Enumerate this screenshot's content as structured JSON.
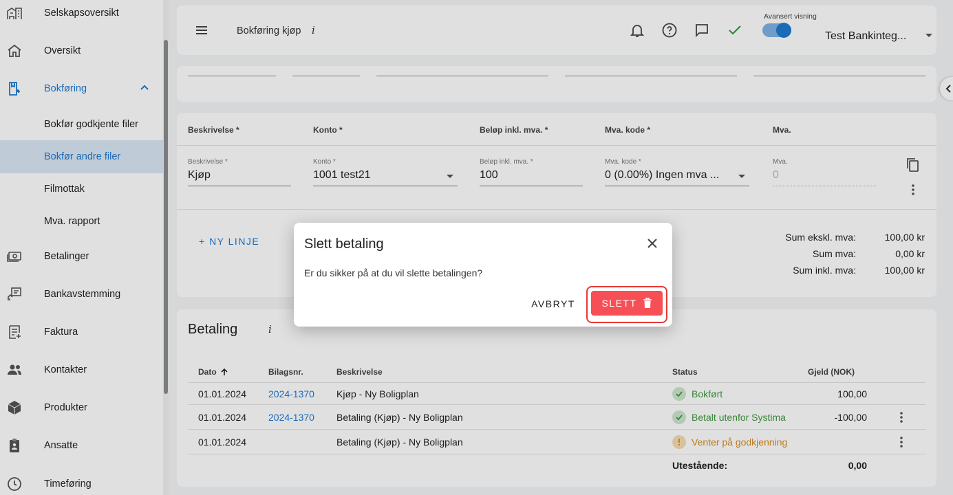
{
  "sidebar": {
    "items": [
      {
        "label": "Selskapsoversikt",
        "icon": "company-overview-icon"
      },
      {
        "label": "Oversikt",
        "icon": "home-icon"
      },
      {
        "label": "Bokføring",
        "icon": "bookkeeping-icon"
      },
      {
        "label": "Bokfør godkjente filer"
      },
      {
        "label": "Bokfør andre filer"
      },
      {
        "label": "Filmottak"
      },
      {
        "label": "Mva. rapport"
      },
      {
        "label": "Betalinger",
        "icon": "payments-icon"
      },
      {
        "label": "Bankavstemming",
        "icon": "bank-reconciliation-icon"
      },
      {
        "label": "Faktura",
        "icon": "invoice-icon"
      },
      {
        "label": "Kontakter",
        "icon": "contacts-icon"
      },
      {
        "label": "Produkter",
        "icon": "products-icon"
      },
      {
        "label": "Ansatte",
        "icon": "employees-icon"
      },
      {
        "label": "Timeføring",
        "icon": "time-tracking-icon"
      }
    ],
    "active_item": "Bokfør andre filer",
    "accent": "#1f7ad0"
  },
  "header": {
    "title": "Bokføring kjøp",
    "info": "i",
    "advanced_view_label": "Avansert visning",
    "advanced_view_on": true,
    "company": "Test Bankinteg..."
  },
  "line_table": {
    "headers": [
      "Beskrivelse *",
      "Konto *",
      "Beløp inkl. mva. *",
      "Mva. kode *",
      "Mva."
    ],
    "row": {
      "beskrivelse_label": "Beskrivelse *",
      "beskrivelse": "Kjøp",
      "konto_label": "Konto *",
      "konto": "1001 test21",
      "belop_label": "Beløp inkl. mva. *",
      "belop": "100",
      "mva_kode_label": "Mva. kode *",
      "mva_kode": "0 (0.00%) Ingen mva ...",
      "mva_label": "Mva.",
      "mva": "0"
    },
    "new_line": "+ NY LINJE",
    "sums": [
      {
        "label": "Sum ekskl. mva:",
        "value": "100,00 kr"
      },
      {
        "label": "Sum mva:",
        "value": "0,00 kr"
      },
      {
        "label": "Sum inkl. mva:",
        "value": "100,00 kr"
      }
    ]
  },
  "betaling": {
    "title": "Betaling",
    "info": "i",
    "columns": [
      "Dato",
      "Bilagsnr.",
      "Beskrivelse",
      "Status",
      "Gjeld (NOK)"
    ],
    "rows": [
      {
        "dato": "01.01.2024",
        "bilag": "2024-1370",
        "beskrivelse": "Kjøp - Ny Boligplan",
        "status": "Bokført",
        "status_type": "success",
        "gjeld": "100,00"
      },
      {
        "dato": "01.01.2024",
        "bilag": "2024-1370",
        "beskrivelse": "Betaling (Kjøp) - Ny Boligplan",
        "status": "Betalt utenfor Systima",
        "status_type": "success",
        "gjeld": "-100,00"
      },
      {
        "dato": "01.01.2024",
        "bilag": "",
        "beskrivelse": "Betaling (Kjøp) - Ny Boligplan",
        "status": "Venter på godkjenning",
        "status_type": "pending",
        "gjeld": ""
      }
    ],
    "outstanding_label": "Utestående:",
    "outstanding_value": "0,00"
  },
  "dialog": {
    "title": "Slett betaling",
    "body": "Er du sikker på at du vil slette betalingen?",
    "cancel": "AVBRYT",
    "delete": "SLETT",
    "delete_color": "#f64f55"
  }
}
